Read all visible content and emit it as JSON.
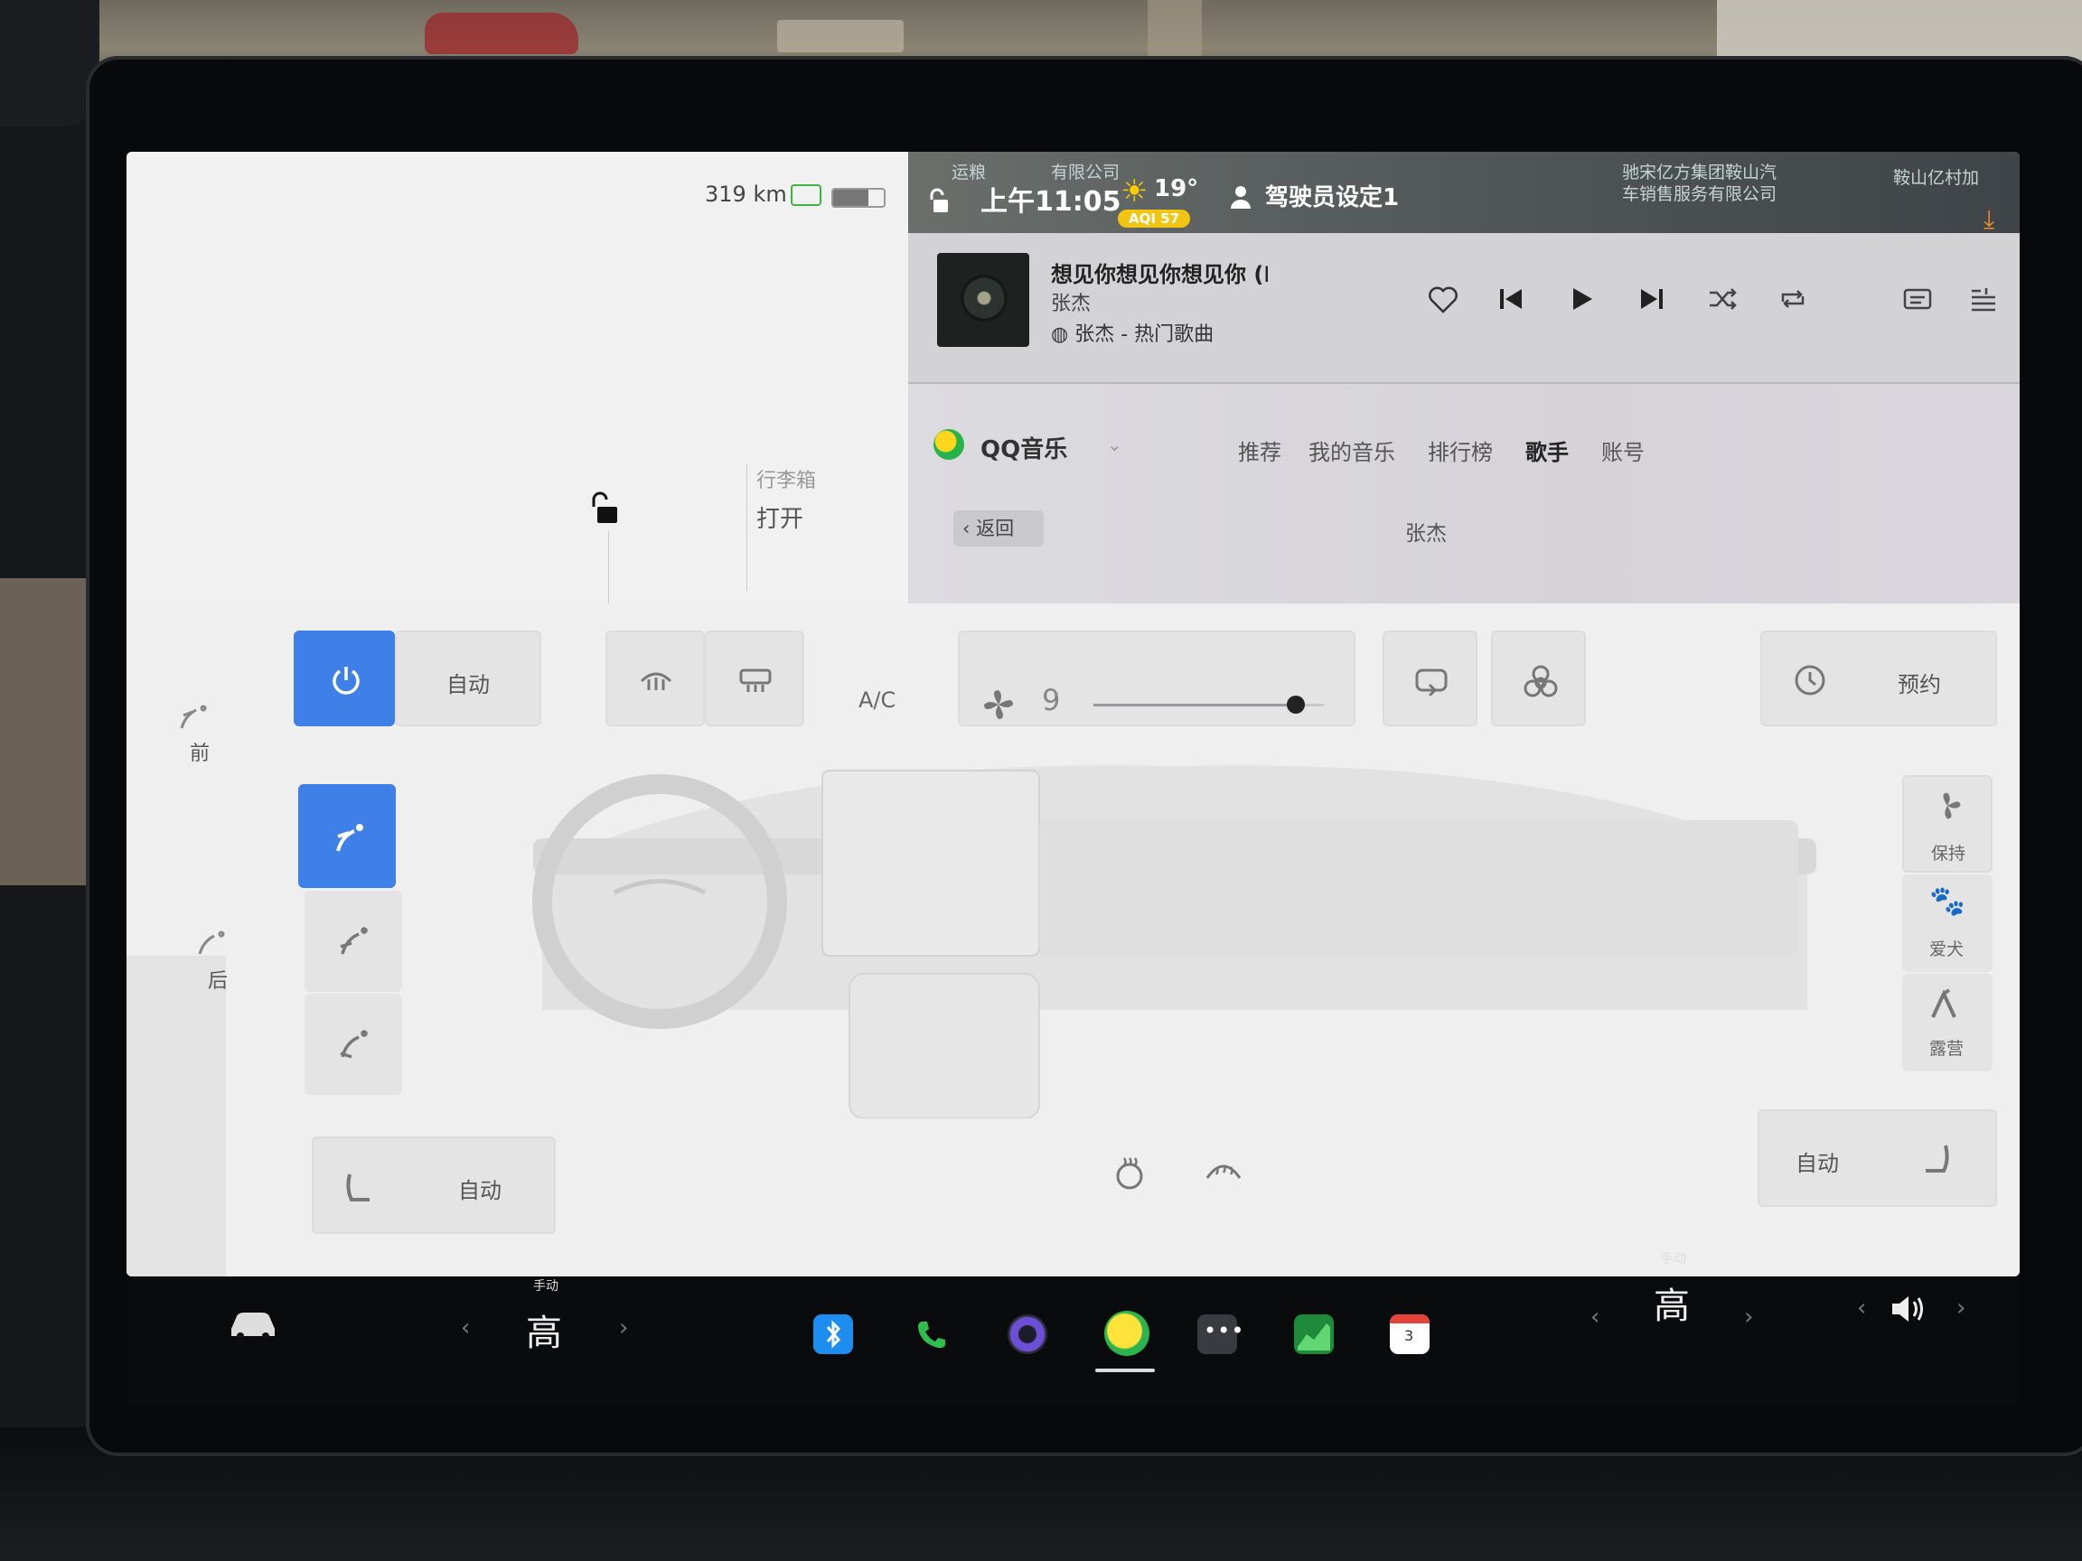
{
  "status": {
    "range": "319 km",
    "battery_level": 0.7,
    "time": "上午11:05",
    "temperature": "19°",
    "aqi": "AQI 57",
    "driver_profile": "驾驶员设定1",
    "poi_1": "运粮",
    "poi_2": "有限公司",
    "poi_3": "驰宋亿方集团鞍山汽",
    "poi_4": "车销售服务有限公司",
    "poi_5": "鞍山亿村加"
  },
  "vehicle": {
    "trunk_label": "行李箱",
    "trunk_action": "打开"
  },
  "music": {
    "song_title": "想见你想见你想见你 (I",
    "artist": "张杰",
    "source": "张杰 - 热门歌曲",
    "app_name": "QQ音乐",
    "tabs": [
      "推荐",
      "我的音乐",
      "排行榜",
      "歌手",
      "账号"
    ],
    "active_tab": "歌手",
    "back_label": "返回",
    "page_title": "张杰"
  },
  "climate": {
    "front_label": "前",
    "rear_label": "后",
    "auto_label": "自动",
    "ac_label": "A/C",
    "fan_speed": "9",
    "fan_level": 0.88,
    "schedule_label": "预约",
    "seat_auto_label": "自动",
    "right_seat_auto_label": "自动",
    "modes": [
      "保持",
      "爱犬",
      "露营"
    ]
  },
  "dock": {
    "left_temp_mode": "手动",
    "left_temp_value": "高",
    "right_temp_mode": "手动",
    "right_temp_value": "高",
    "calendar_day": "3"
  },
  "colors": {
    "accent_blue": "#3e7fe8",
    "aqi_yellow": "#f3c513",
    "battery_green": "#43b14a"
  }
}
